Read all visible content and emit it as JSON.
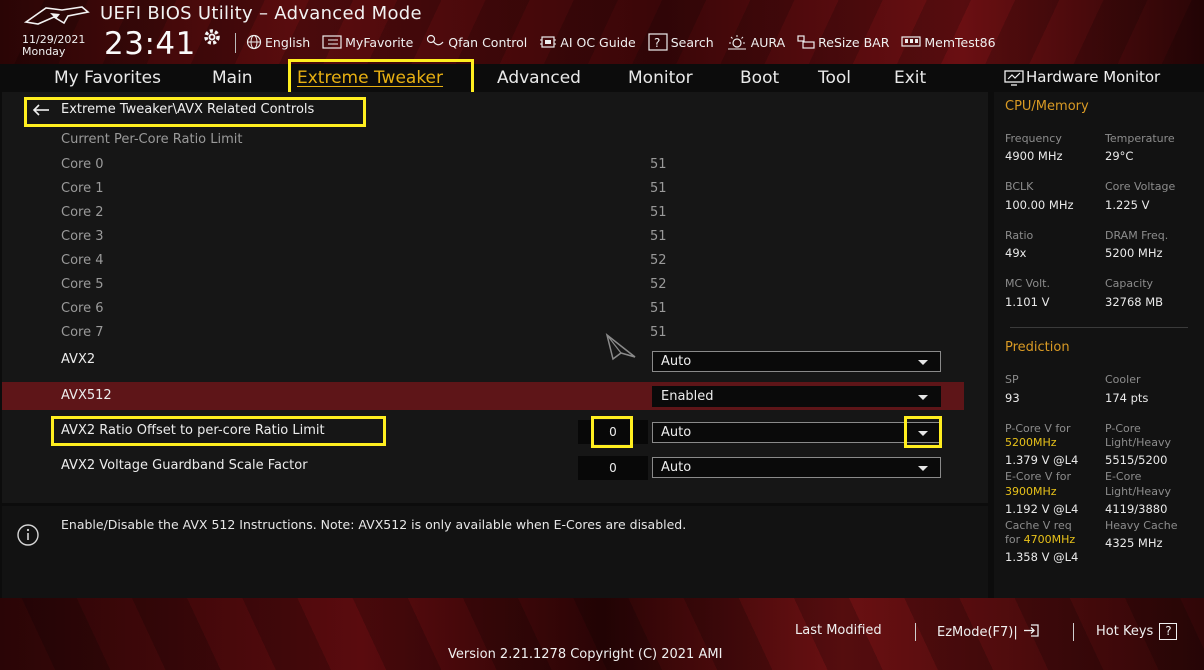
{
  "header": {
    "title": "UEFI BIOS Utility – Advanced Mode",
    "date": "11/29/2021",
    "day": "Monday",
    "time": "23:41",
    "toolbar": {
      "language": "English",
      "my_favorite": "MyFavorite",
      "qfan": "Qfan Control",
      "ai_oc": "AI OC Guide",
      "search": "Search",
      "aura": "AURA",
      "resize_bar": "ReSize BAR",
      "memtest": "MemTest86"
    }
  },
  "nav": {
    "tabs": [
      "My Favorites",
      "Main",
      "Extreme Tweaker",
      "Advanced",
      "Monitor",
      "Boot",
      "Tool",
      "Exit"
    ],
    "active": "Extreme Tweaker"
  },
  "breadcrumb": "Extreme Tweaker\\AVX Related Controls",
  "settings": {
    "section_label": "Current Per-Core Ratio Limit",
    "cores": [
      {
        "label": "Core 0",
        "value": "51"
      },
      {
        "label": "Core 1",
        "value": "51"
      },
      {
        "label": "Core 2",
        "value": "51"
      },
      {
        "label": "Core 3",
        "value": "51"
      },
      {
        "label": "Core 4",
        "value": "52"
      },
      {
        "label": "Core 5",
        "value": "52"
      },
      {
        "label": "Core 6",
        "value": "51"
      },
      {
        "label": "Core 7",
        "value": "51"
      }
    ],
    "avx2": {
      "label": "AVX2",
      "value": "Auto"
    },
    "avx512": {
      "label": "AVX512",
      "value": "Enabled"
    },
    "avx2_ratio_offset": {
      "label": "AVX2 Ratio Offset to per-core Ratio Limit",
      "number": "0",
      "value": "Auto"
    },
    "avx2_voltage_guardband": {
      "label": "AVX2 Voltage Guardband Scale Factor",
      "number": "0",
      "value": "Auto"
    }
  },
  "help": {
    "text": "Enable/Disable the AVX 512 Instructions. Note: AVX512 is only available when E-Cores are disabled."
  },
  "hardware_monitor": {
    "title": "Hardware Monitor",
    "cpu_memory": {
      "section": "CPU/Memory",
      "frequency_label": "Frequency",
      "frequency": "4900 MHz",
      "temperature_label": "Temperature",
      "temperature": "29°C",
      "bclk_label": "BCLK",
      "bclk": "100.00 MHz",
      "core_voltage_label": "Core Voltage",
      "core_voltage": "1.225 V",
      "ratio_label": "Ratio",
      "ratio": "49x",
      "dram_freq_label": "DRAM Freq.",
      "dram_freq": "5200 MHz",
      "mc_volt_label": "MC Volt.",
      "mc_volt": "1.101 V",
      "capacity_label": "Capacity",
      "capacity": "32768 MB"
    },
    "prediction": {
      "section": "Prediction",
      "sp_label": "SP",
      "sp": "93",
      "cooler_label": "Cooler",
      "cooler": "174 pts",
      "pcore_v_label": "P-Core V for",
      "pcore_v_freq": "5200MHz",
      "pcore_v": "1.379 V @L4",
      "pcore_lh_label_1": "P-Core",
      "pcore_lh_label_2": "Light/Heavy",
      "pcore_lh": "5515/5200",
      "ecore_v_label": "E-Core V for",
      "ecore_v_freq": "3900MHz",
      "ecore_v": "1.192 V @L4",
      "ecore_lh_label_1": "E-Core",
      "ecore_lh_label_2": "Light/Heavy",
      "ecore_lh": "4119/3880",
      "cache_v_label_1": "Cache V req",
      "cache_v_label_2": "for",
      "cache_v_freq": "4700MHz",
      "cache_v": "1.358 V @L4",
      "heavy_cache_label": "Heavy Cache",
      "heavy_cache": "4325 MHz"
    }
  },
  "footer": {
    "last_modified": "Last Modified",
    "ezmode": "EzMode(F7)|",
    "hot_keys": "Hot Keys",
    "hot_keys_icon": "?",
    "version": "Version 2.21.1278 Copyright (C) 2021 AMI"
  },
  "colors": {
    "accent_yellow": "#e8b012",
    "highlight_box": "#ffee1f",
    "selected_row": "#5e1518",
    "hw_section": "#d99a24"
  }
}
